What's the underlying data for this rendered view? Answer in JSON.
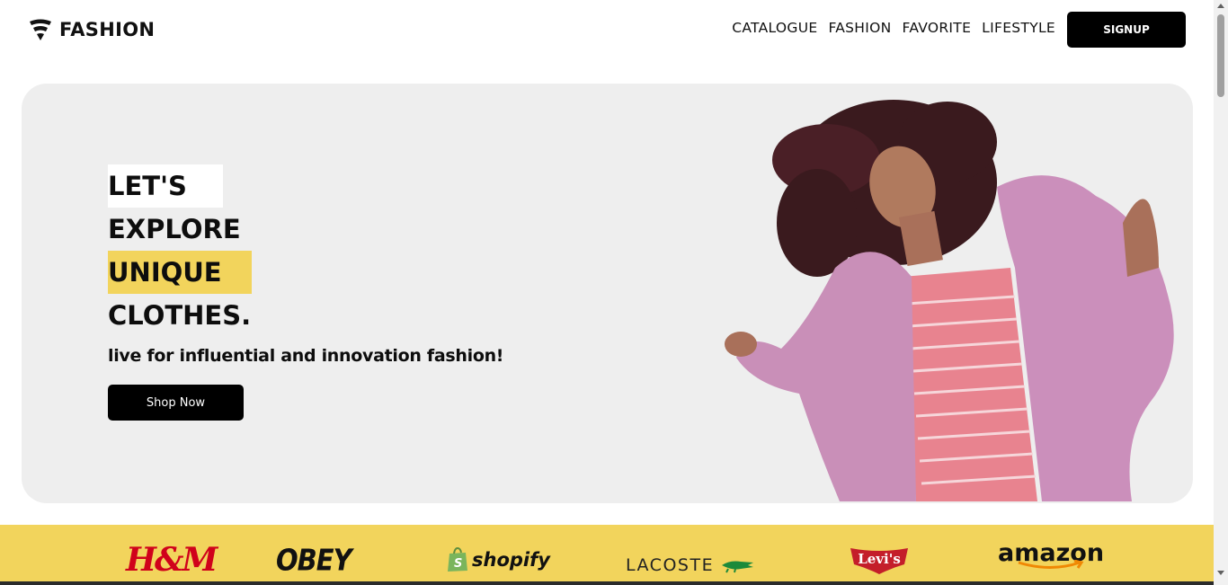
{
  "header": {
    "logo_text": "FASHION",
    "nav": [
      "CATALOGUE",
      "FASHION",
      "FAVORITE",
      "LIFESTYLE"
    ],
    "signup_label": "SIGNUP"
  },
  "hero": {
    "lines": [
      "LET'S",
      "EXPLORE",
      "UNIQUE",
      "CLOTHES."
    ],
    "tagline": "live for influential and innovation fashion!",
    "cta_label": "Shop Now"
  },
  "brands": {
    "hm": "H&M",
    "obey": "OBEY",
    "shopify": "shopify",
    "lacoste": "LACOSTE",
    "levis": "Levi's",
    "amazon": "amazon"
  },
  "colors": {
    "accent_yellow": "#f2d45c",
    "hero_bg": "#eeeeee",
    "button_black": "#000000"
  }
}
